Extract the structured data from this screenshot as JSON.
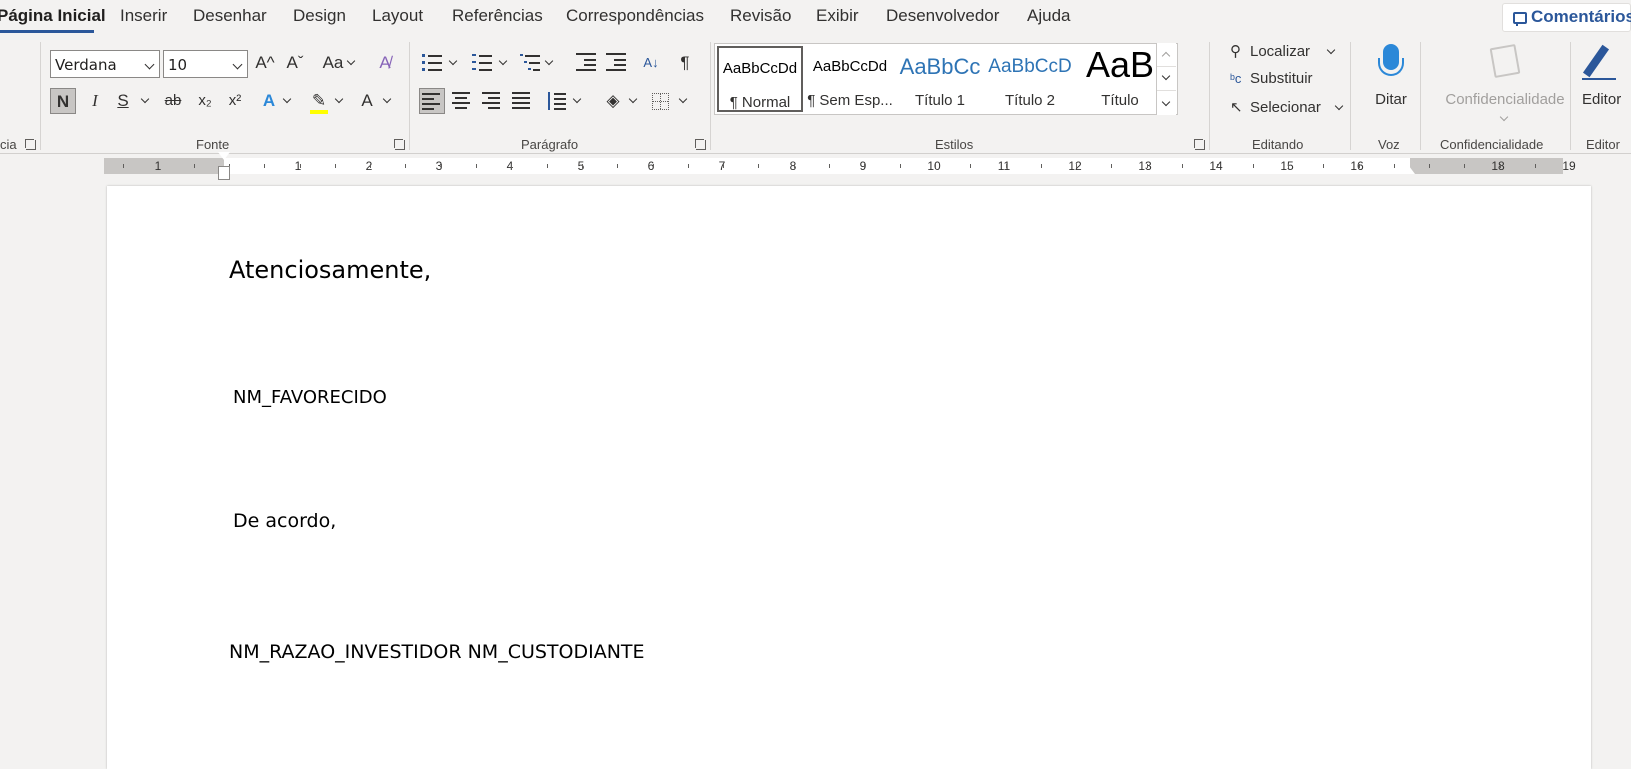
{
  "tabs": [
    "Página Inicial",
    "Inserir",
    "Desenhar",
    "Design",
    "Layout",
    "Referências",
    "Correspondências",
    "Revisão",
    "Exibir",
    "Desenvolvedor",
    "Ajuda"
  ],
  "comments_label": "Comentários",
  "ribbon": {
    "clipboard_partial_label": "cia",
    "font": {
      "name": "Verdana",
      "size": "10",
      "grow": "A^",
      "shrink": "Aˇ",
      "case": "Aa",
      "bold": "N",
      "italic": "I",
      "underline": "S",
      "strike": "ab",
      "subscript": "x₂",
      "superscript": "x²",
      "group_label": "Fonte",
      "highlight_color": "#ffff00",
      "text_effect_color": "#2b88d8"
    },
    "paragraph": {
      "group_label": "Parágrafo"
    },
    "styles": {
      "items": [
        {
          "preview": "AaBbCcDd",
          "name": "¶ Normal"
        },
        {
          "preview": "AaBbCcDd",
          "name": "¶ Sem Esp..."
        },
        {
          "preview": "AaBbCc",
          "name": "Título 1"
        },
        {
          "preview": "AaBbCcD",
          "name": "Título 2"
        },
        {
          "preview": "AaB",
          "name": "Título"
        }
      ],
      "group_label": "Estilos",
      "heading_color": "#2e74b5"
    },
    "editing": {
      "find": "Localizar",
      "replace": "Substituir",
      "select": "Selecionar",
      "group_label": "Editando"
    },
    "voice": {
      "dictate": "Ditar",
      "group_label": "Voz"
    },
    "sensitivity": {
      "label": "Confidencialidade",
      "group_label": "Confidencialidade"
    },
    "editor": {
      "label": "Editor",
      "group_label": "Editor"
    }
  },
  "ruler": {
    "left_numbers": [
      "1"
    ],
    "numbers": [
      "1",
      "2",
      "3",
      "4",
      "5",
      "6",
      "7",
      "8",
      "9",
      "10",
      "11",
      "12",
      "13",
      "14",
      "15",
      "16",
      "18",
      "19"
    ]
  },
  "document": {
    "lines": [
      "Atenciosamente,",
      "NM_FAVORECIDO",
      "De acordo,",
      "NM_RAZAO_INVESTIDOR NM_CUSTODIANTE"
    ]
  }
}
